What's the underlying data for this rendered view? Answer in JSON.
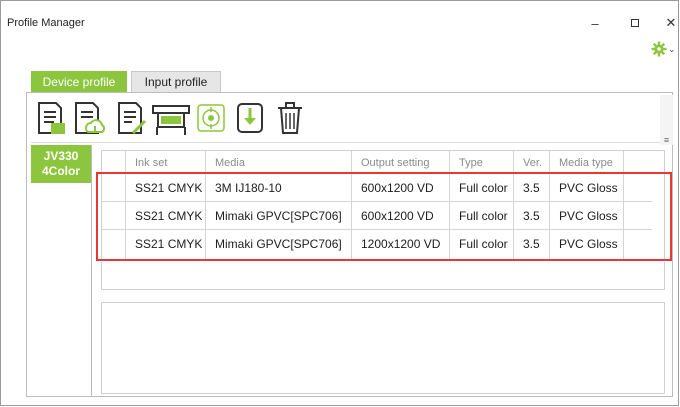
{
  "window": {
    "title": "Profile Manager",
    "minimize_glyph": "–",
    "close_glyph": "✕"
  },
  "settings": {
    "icon": "gear-icon",
    "color": "#8cc63f"
  },
  "tabs": [
    {
      "label": "Device profile",
      "active": true
    },
    {
      "label": "Input profile",
      "active": false
    }
  ],
  "toolbar": {
    "buttons": [
      {
        "name": "profile-list-icon"
      },
      {
        "name": "upload-profile-icon"
      },
      {
        "name": "edit-profile-icon"
      },
      {
        "name": "printer-settings-icon"
      },
      {
        "name": "target-icon"
      },
      {
        "name": "download-icon"
      },
      {
        "name": "trash-icon"
      }
    ]
  },
  "printer": {
    "model": "JV330",
    "color_mode": "4Color"
  },
  "table": {
    "columns": [
      "Ink set",
      "Media",
      "Output setting",
      "Type",
      "Ver.",
      "Media type"
    ],
    "rows": [
      [
        "SS21 CMYK",
        "3M IJ180-10",
        "600x1200 VD",
        "Full color",
        "3.5",
        "PVC Gloss"
      ],
      [
        "SS21 CMYK",
        "Mimaki GPVC[SPC706]",
        "600x1200 VD",
        "Full color",
        "3.5",
        "PVC Gloss"
      ],
      [
        "SS21 CMYK",
        "Mimaki GPVC[SPC706]",
        "1200x1200 VD",
        "Full color",
        "3.5",
        "PVC Gloss"
      ]
    ]
  },
  "colors": {
    "accent": "#8cc63f",
    "highlight": "#e53935"
  }
}
